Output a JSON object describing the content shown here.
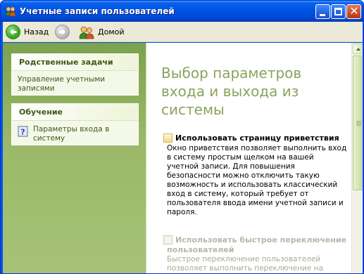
{
  "window": {
    "title": "Учетные записи пользователей"
  },
  "toolbar": {
    "back_label": "Назад",
    "home_label": "Домой"
  },
  "sidebar": {
    "related_tasks": {
      "heading": "Родственные задачи",
      "items": [
        {
          "label": "Управление учетными записями"
        }
      ]
    },
    "learn": {
      "heading": "Обучение",
      "items": [
        {
          "label": "Параметры входа в систему"
        }
      ]
    }
  },
  "main": {
    "title": "Выбор параметров входа и выхода из системы",
    "options": [
      {
        "label": "Использовать страницу приветствия",
        "checked": false,
        "enabled": true,
        "description": "Окно приветствия позволяет выполнить вход в систему простым щелком на вашей учетной записи. Для повышения безопасности можно отключить такую возможность и использовать классический вход в систему, который требует от пользователя ввода имени учетной записи и пароля."
      },
      {
        "label": "Использовать быстрое переключение",
        "label_cont": "пользователей",
        "checked": false,
        "enabled": false,
        "description": "Быстрое переключение пользователей позволяет выполнить переключение на"
      }
    ]
  },
  "colors": {
    "titlebar": "#0055e5",
    "sidebar": "#9ab867",
    "title_text_main": "#8aa35c",
    "sidebar_link": "#3e5a18"
  },
  "icons": {
    "title": "user-accounts-icon",
    "back": "back-arrow-icon",
    "forward": "forward-arrow-icon",
    "home": "home-users-icon",
    "help": "help-question-icon"
  }
}
